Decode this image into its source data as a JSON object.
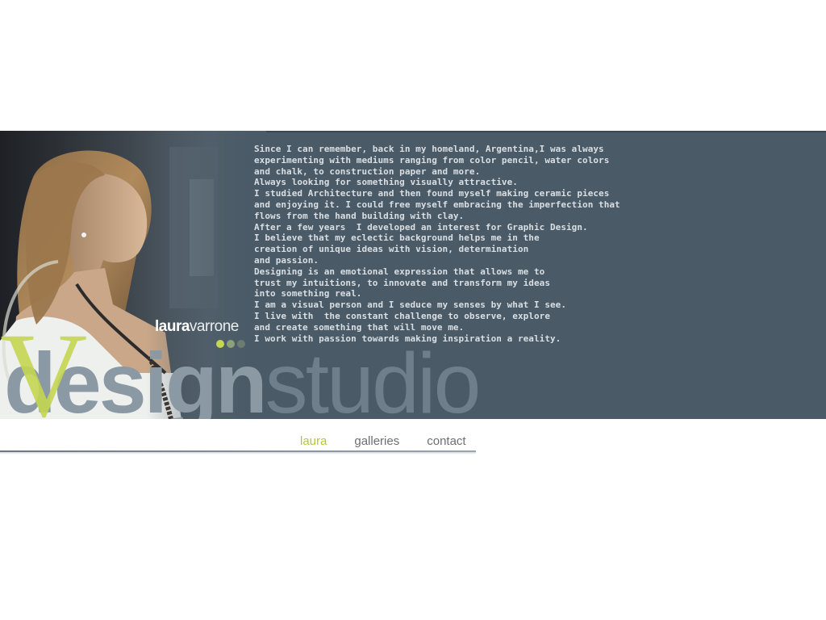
{
  "bio_lines": [
    "Since I can remember, back in my homeland, Argentina,I was always",
    "experimenting with mediums ranging from color pencil, water colors",
    "and chalk, to construction paper and more.",
    "Always looking for something visually attractive.",
    "I studied Architecture and then found myself making ceramic pieces",
    "and enjoying it. I could free myself embracing the imperfection that",
    "flows from the hand building with clay.",
    "After a few years  I developed an interest for Graphic Design.",
    "I believe that my eclectic background helps me in the",
    "creation of unique ideas with vision, determination",
    "and passion.",
    "Designing is an emotional expression that allows me to",
    "trust my intuitions, to innovate and transform my ideas",
    "into something real.",
    "I am a visual person and I seduce my senses by what I see.",
    "I live with  the constant challenge to observe, explore",
    "and create something that will move me.",
    "I work with passion towards making inspiration a reality."
  ],
  "signature": {
    "first": "laura",
    "last": "varrone"
  },
  "logo": {
    "letter": "V",
    "word1": "design",
    "word2": "studio"
  },
  "dots": [
    "#c5d651",
    "#8ea07a",
    "#6b7c73"
  ],
  "nav": {
    "items": [
      "laura",
      "galleries",
      "contact"
    ],
    "active": "laura"
  },
  "colors": {
    "banner": "#4a5a66",
    "accent": "#b4c73e",
    "text": "#d9dfe4"
  }
}
